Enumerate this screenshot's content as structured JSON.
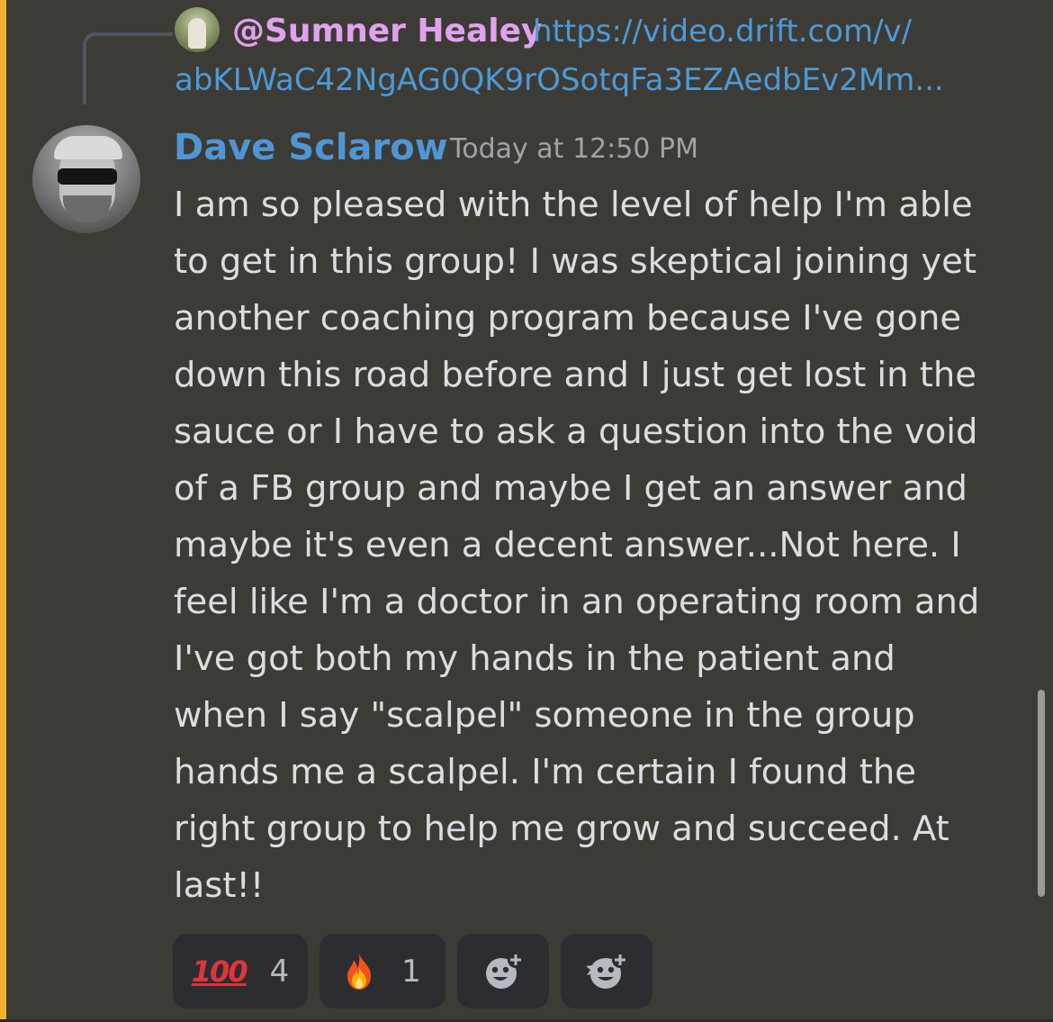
{
  "reply": {
    "author": "@Sumner Healey",
    "link_line1": "https://video.drift.com/v/",
    "link_line2": "abKLWaC42NgAG0QK9rOSotqFa3EZAedbEv2Mm..."
  },
  "message": {
    "author": "Dave Sclarow",
    "timestamp": "Today at 12:50 PM",
    "text": "I am so pleased with the level of help I'm able\nto get in this group! I was skeptical joining yet\nanother coaching program because I've gone\ndown this road before and I just get lost in the\nsauce or I have to ask a question into the void\nof a FB group and maybe I get an answer and\nmaybe it's even a decent answer...Not here. I\nfeel like I'm a doctor in an operating room and\nI've got both my hands in the patient and\nwhen I say \"scalpel\" someone in the group\nhands me a scalpel. I'm certain I found the\nright group to help me grow and succeed. At\nlast!!"
  },
  "reactions": [
    {
      "emoji": "100",
      "count": "4"
    },
    {
      "emoji": "fire",
      "count": "1"
    }
  ],
  "add_buttons": [
    {
      "icon": "add-reaction-icon"
    },
    {
      "icon": "add-super-reaction-icon"
    }
  ],
  "colors": {
    "background": "#3d3b36",
    "highlight": "#f0b232",
    "author": "#4f96d4",
    "reply_author": "#e0a2ee",
    "link": "#4d9ad6",
    "text": "#dbdee1"
  }
}
